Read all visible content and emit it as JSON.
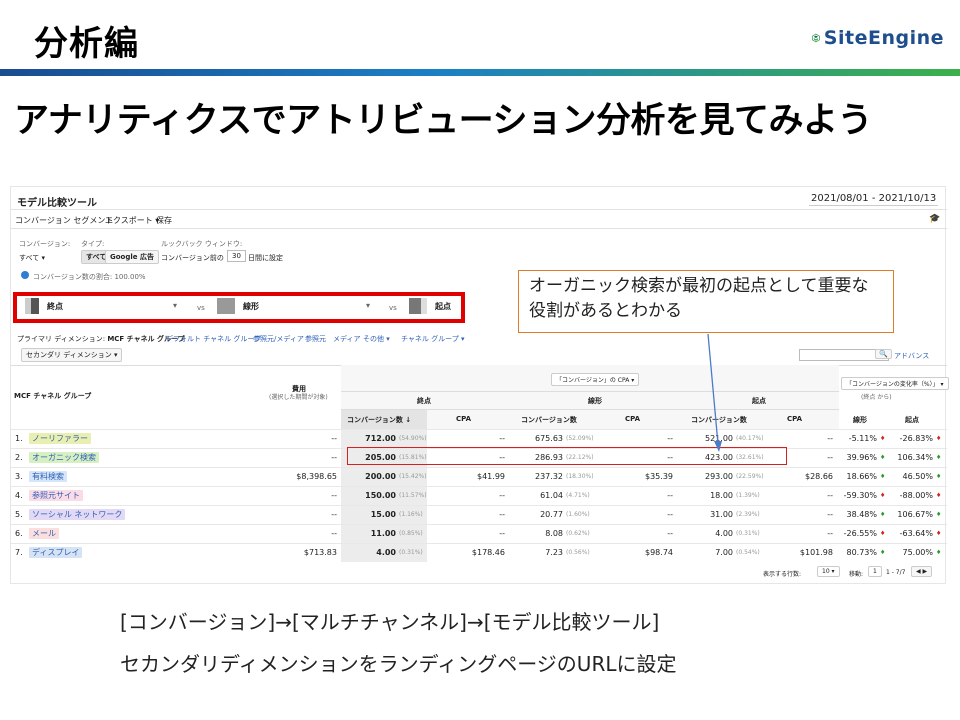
{
  "slide": {
    "section_title": "分析編",
    "logo_text": "SiteEngine",
    "main_title": "アナリティクスでアトリビューション分析を見てみよう",
    "callout": "オーガニック検索が最初の起点として重要な役割があるとわかる",
    "footer_line1": "[コンバージョン]→[マルチチャンネル]→[モデル比較ツール]",
    "footer_line2": "セカンダリディメンションをランディングページのURLに設定"
  },
  "ga": {
    "page_title": "モデル比較ツール",
    "date_range": "2021/08/01 - 2021/10/13",
    "toolbar": [
      "コンバージョン セグメント",
      "エクスポート ▾",
      "保存"
    ],
    "label_conversion": "コンバージョン:",
    "conversion_value": "すべて ▾",
    "label_type": "タイプ:",
    "type_all": "すべて",
    "type_ads": "Google 広告",
    "label_lookback": "ルックバック ウィンドウ:",
    "lookback_prefix": "コンバージョン前の",
    "lookback_days": "30",
    "lookback_suffix": "日間に設定",
    "share_note": "コンバージョン数の割合: 100.00%",
    "model1": "終点",
    "model2": "線形",
    "model3": "起点",
    "vs": "vs",
    "dim_label": "プライマリ ディメンション:",
    "dim_items": [
      "MCF チャネル グループ",
      "デフォルト チャネル グループ",
      "参照元/メディア",
      "参照元",
      "メディア",
      "その他 ▾",
      "チャネル グループ ▾"
    ],
    "secondary_dim": "セカンダリ ディメンション ▾",
    "advanced": "アドバンス",
    "col_group": "MCF チャネル グループ",
    "col_cost": "費用",
    "col_cost_sub": "(選択した期間が対象)",
    "col_conv": "コンバージョン数",
    "col_cpa": "CPA",
    "col_change": "「コンバージョンの変化率（%）」",
    "col_change_sub": "(終点 から)",
    "cpa_dropdown": "「コンバージョン」の CPA",
    "change_model1": "線形",
    "change_model2": "起点",
    "rows": [
      {
        "n": "1.",
        "name": "ノーリファラー",
        "cost": "--",
        "c1": "712.00",
        "p1": "(54.90%)",
        "cpa1": "--",
        "c2": "675.63",
        "p2": "(52.09%)",
        "cpa2": "--",
        "c3": "521.00",
        "p3": "(40.17%)",
        "cpa3": "--",
        "ch1": "-5.11%",
        "ch2": "-26.83%"
      },
      {
        "n": "2.",
        "name": "オーガニック検索",
        "cost": "--",
        "c1": "205.00",
        "p1": "(15.81%)",
        "cpa1": "--",
        "c2": "286.93",
        "p2": "(22.12%)",
        "cpa2": "--",
        "c3": "423.00",
        "p3": "(32.61%)",
        "cpa3": "--",
        "ch1": "39.96%",
        "ch2": "106.34%"
      },
      {
        "n": "3.",
        "name": "有料検索",
        "cost": "$8,398.65",
        "c1": "200.00",
        "p1": "(15.42%)",
        "cpa1": "$41.99",
        "c2": "237.32",
        "p2": "(18.30%)",
        "cpa2": "$35.39",
        "c3": "293.00",
        "p3": "(22.59%)",
        "cpa3": "$28.66",
        "ch1": "18.66%",
        "ch2": "46.50%"
      },
      {
        "n": "4.",
        "name": "参照元サイト",
        "cost": "--",
        "c1": "150.00",
        "p1": "(11.57%)",
        "cpa1": "--",
        "c2": "61.04",
        "p2": "(4.71%)",
        "cpa2": "--",
        "c3": "18.00",
        "p3": "(1.39%)",
        "cpa3": "--",
        "ch1": "-59.30%",
        "ch2": "-88.00%"
      },
      {
        "n": "5.",
        "name": "ソーシャル ネットワーク",
        "cost": "--",
        "c1": "15.00",
        "p1": "(1.16%)",
        "cpa1": "--",
        "c2": "20.77",
        "p2": "(1.60%)",
        "cpa2": "--",
        "c3": "31.00",
        "p3": "(2.39%)",
        "cpa3": "--",
        "ch1": "38.48%",
        "ch2": "106.67%"
      },
      {
        "n": "6.",
        "name": "メール",
        "cost": "--",
        "c1": "11.00",
        "p1": "(0.85%)",
        "cpa1": "--",
        "c2": "8.08",
        "p2": "(0.62%)",
        "cpa2": "--",
        "c3": "4.00",
        "p3": "(0.31%)",
        "cpa3": "--",
        "ch1": "-26.55%",
        "ch2": "-63.64%"
      },
      {
        "n": "7.",
        "name": "ディスプレイ",
        "cost": "$713.83",
        "c1": "4.00",
        "p1": "(0.31%)",
        "cpa1": "$178.46",
        "c2": "7.23",
        "p2": "(0.56%)",
        "cpa2": "$98.74",
        "c3": "7.00",
        "p3": "(0.54%)",
        "cpa3": "$101.98",
        "ch1": "80.73%",
        "ch2": "75.00%"
      }
    ],
    "pager_label": "表示する行数:",
    "pager_rows": "10",
    "pager_goto": "移動:",
    "pager_page": "1",
    "pager_range": "1 - 7/7",
    "colors": {
      "tag1": "#e8efb0",
      "tag2": "#d7f0c2",
      "tag3": "#d6e6fa",
      "tag4": "#fbdbe6",
      "tag5": "#e3d9f5",
      "tag6": "#fbdede",
      "tag7": "#d6e3f5"
    }
  }
}
